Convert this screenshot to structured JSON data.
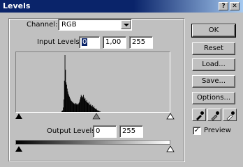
{
  "window": {
    "title": "Levels",
    "close_glyph": "✕",
    "help_glyph": "?"
  },
  "channel": {
    "label": "Channel:",
    "value": "RGB"
  },
  "input_levels": {
    "label": "Input Levels:",
    "black": "0",
    "gamma": "1,00",
    "white": "255"
  },
  "output_levels": {
    "label": "Output Levels:",
    "black": "0",
    "white": "255"
  },
  "buttons": {
    "ok": "OK",
    "reset": "Reset",
    "load": "Load...",
    "save": "Save...",
    "options": "Options..."
  },
  "eyedroppers": [
    "black-point-eyedropper-icon",
    "gray-point-eyedropper-icon",
    "white-point-eyedropper-icon"
  ],
  "preview": {
    "label": "Preview",
    "checked": true,
    "check_glyph": "✓"
  },
  "histogram": {
    "levels": [
      0,
      0,
      0,
      0,
      0,
      0,
      0,
      0,
      0,
      0,
      0,
      0,
      0,
      0,
      0,
      0,
      0,
      0,
      0,
      0,
      0,
      0,
      0,
      0,
      0,
      0,
      0,
      0,
      0,
      0,
      0,
      0,
      0,
      0,
      0,
      0,
      0,
      0,
      0,
      0,
      0,
      0,
      0,
      0,
      0,
      0,
      0,
      0,
      0,
      0,
      0,
      0,
      0,
      0,
      0,
      0,
      0,
      0,
      0,
      0,
      0,
      0,
      0,
      0,
      0,
      0,
      0,
      0,
      0,
      0,
      0,
      0,
      0,
      0,
      0,
      0,
      0,
      0,
      0,
      0,
      0,
      1,
      2,
      3,
      8,
      22,
      55,
      100,
      74,
      52,
      48,
      41,
      36,
      32,
      29,
      27,
      24,
      22,
      20,
      19,
      17,
      18,
      16,
      15,
      14,
      16,
      15,
      13,
      15,
      14,
      13,
      14,
      16,
      18,
      22,
      26,
      30,
      28,
      25,
      27,
      30,
      26,
      23,
      24,
      20,
      18,
      21,
      17,
      16,
      15,
      18,
      13,
      12,
      14,
      11,
      10,
      12,
      9,
      8,
      10,
      7,
      6,
      5,
      6,
      4,
      3,
      3,
      2,
      2,
      1,
      1,
      0,
      0,
      0,
      0,
      0,
      0,
      0,
      0,
      0,
      0,
      0,
      0,
      0,
      0,
      0,
      0,
      0,
      0,
      0,
      0,
      0,
      0,
      0,
      0,
      0,
      0,
      0,
      0,
      0,
      0,
      0,
      0,
      0,
      0,
      0,
      0,
      0,
      0,
      0,
      0,
      0,
      0,
      0,
      0,
      0,
      0,
      0,
      0,
      0,
      0,
      0,
      0,
      0,
      0,
      0,
      0,
      0,
      0,
      0,
      0,
      0,
      0,
      0,
      0,
      0,
      0,
      0,
      0,
      0,
      0,
      0,
      0,
      0,
      0,
      0,
      0,
      0,
      0,
      0,
      0,
      0,
      0,
      0,
      0,
      0,
      0,
      0,
      0,
      0,
      0,
      0,
      0,
      0,
      0,
      0,
      0,
      0,
      0,
      0,
      0,
      0,
      0,
      0,
      0,
      0,
      0,
      0,
      0,
      0,
      0,
      0,
      0,
      0,
      0,
      0,
      0,
      0,
      0,
      0,
      0,
      0,
      0,
      0,
      0
    ],
    "input_black": 0,
    "input_gamma": 1.0,
    "input_white": 255,
    "output_black": 0,
    "output_white": 255
  },
  "colors": {
    "titlebar_start": "#0a246a",
    "titlebar_end": "#a6caf0",
    "face": "#c0c0c0",
    "histogram_bars": "#000000"
  }
}
